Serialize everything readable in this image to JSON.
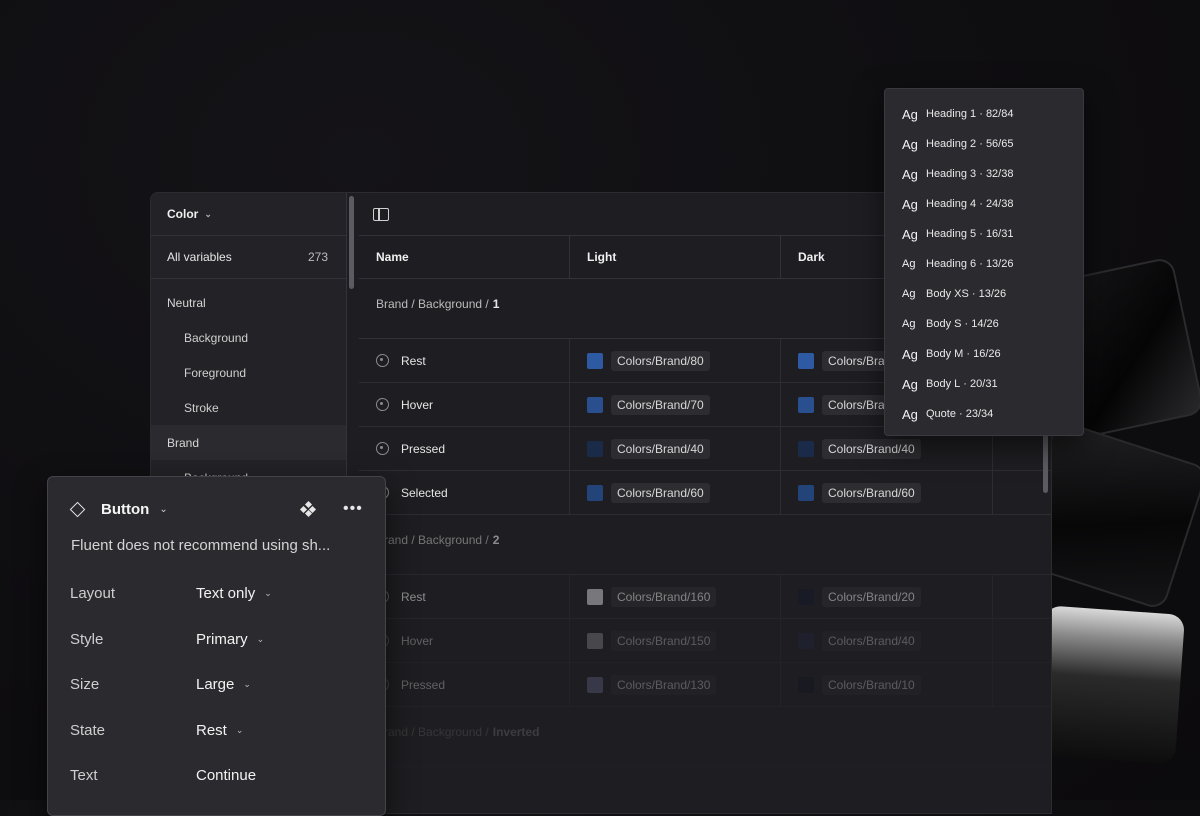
{
  "sidebar": {
    "collection": "Color",
    "all_variables_label": "All variables",
    "all_variables_count": "273",
    "groups": [
      {
        "label": "Neutral",
        "items": [
          "Background",
          "Foreground",
          "Stroke"
        ]
      },
      {
        "label": "Brand",
        "items": [
          "Background"
        ]
      }
    ]
  },
  "table": {
    "columns": [
      "Name",
      "Light",
      "Dark"
    ],
    "groups": [
      {
        "path": "Brand / Background /",
        "bold": "1",
        "rows": [
          {
            "name": "Rest",
            "light": "Colors/Brand/80",
            "light_color": "#2d5aa3",
            "dark": "Colors/Brand/80",
            "dark_color": "#2d5aa3"
          },
          {
            "name": "Hover",
            "light": "Colors/Brand/70",
            "light_color": "#2a4f8f",
            "dark": "Colors/Brand/70",
            "dark_color": "#2a4f8f"
          },
          {
            "name": "Pressed",
            "light": "Colors/Brand/40",
            "light_color": "#1a2b4a",
            "dark": "Colors/Brand/40",
            "dark_color": "#1a2b4a"
          },
          {
            "name": "Selected",
            "light": "Colors/Brand/60",
            "light_color": "#234478",
            "dark": "Colors/Brand/60",
            "dark_color": "#234478"
          }
        ]
      },
      {
        "path": "Brand / Background /",
        "bold": "2",
        "rows": [
          {
            "name": "Rest",
            "light": "Colors/Brand/160",
            "light_color": "#c2c2c8",
            "dark": "Colors/Brand/20",
            "dark_color": "#141a2a"
          },
          {
            "name": "Hover",
            "light": "Colors/Brand/150",
            "light_color": "#9c9ca4",
            "dark": "Colors/Brand/40",
            "dark_color": "#1e2a48"
          },
          {
            "name": "Pressed",
            "light": "Colors/Brand/130",
            "light_color": "#6a7198",
            "dark": "Colors/Brand/10",
            "dark_color": "#101622"
          }
        ]
      },
      {
        "path": "Brand / Background /",
        "bold": "Inverted",
        "rows": []
      }
    ]
  },
  "text_styles": [
    {
      "name": "Heading 1",
      "spec": "82/84"
    },
    {
      "name": "Heading 2",
      "spec": "56/65"
    },
    {
      "name": "Heading 3",
      "spec": "32/38"
    },
    {
      "name": "Heading 4",
      "spec": "24/38"
    },
    {
      "name": "Heading 5",
      "spec": "16/31"
    },
    {
      "name": "Heading 6",
      "spec": "13/26"
    },
    {
      "name": "Body XS",
      "spec": "13/26"
    },
    {
      "name": "Body S",
      "spec": "14/26"
    },
    {
      "name": "Body M",
      "spec": "16/26"
    },
    {
      "name": "Body L",
      "spec": "20/31"
    },
    {
      "name": "Quote",
      "spec": "23/34"
    }
  ],
  "props_panel": {
    "component": "Button",
    "warning": "Fluent does not recommend using sh...",
    "properties": [
      {
        "label": "Layout",
        "value": "Text only",
        "dropdown": true
      },
      {
        "label": "Style",
        "value": "Primary",
        "dropdown": true
      },
      {
        "label": "Size",
        "value": "Large",
        "dropdown": true
      },
      {
        "label": "State",
        "value": "Rest",
        "dropdown": true
      },
      {
        "label": "Text",
        "value": "Continue",
        "dropdown": false
      }
    ]
  }
}
